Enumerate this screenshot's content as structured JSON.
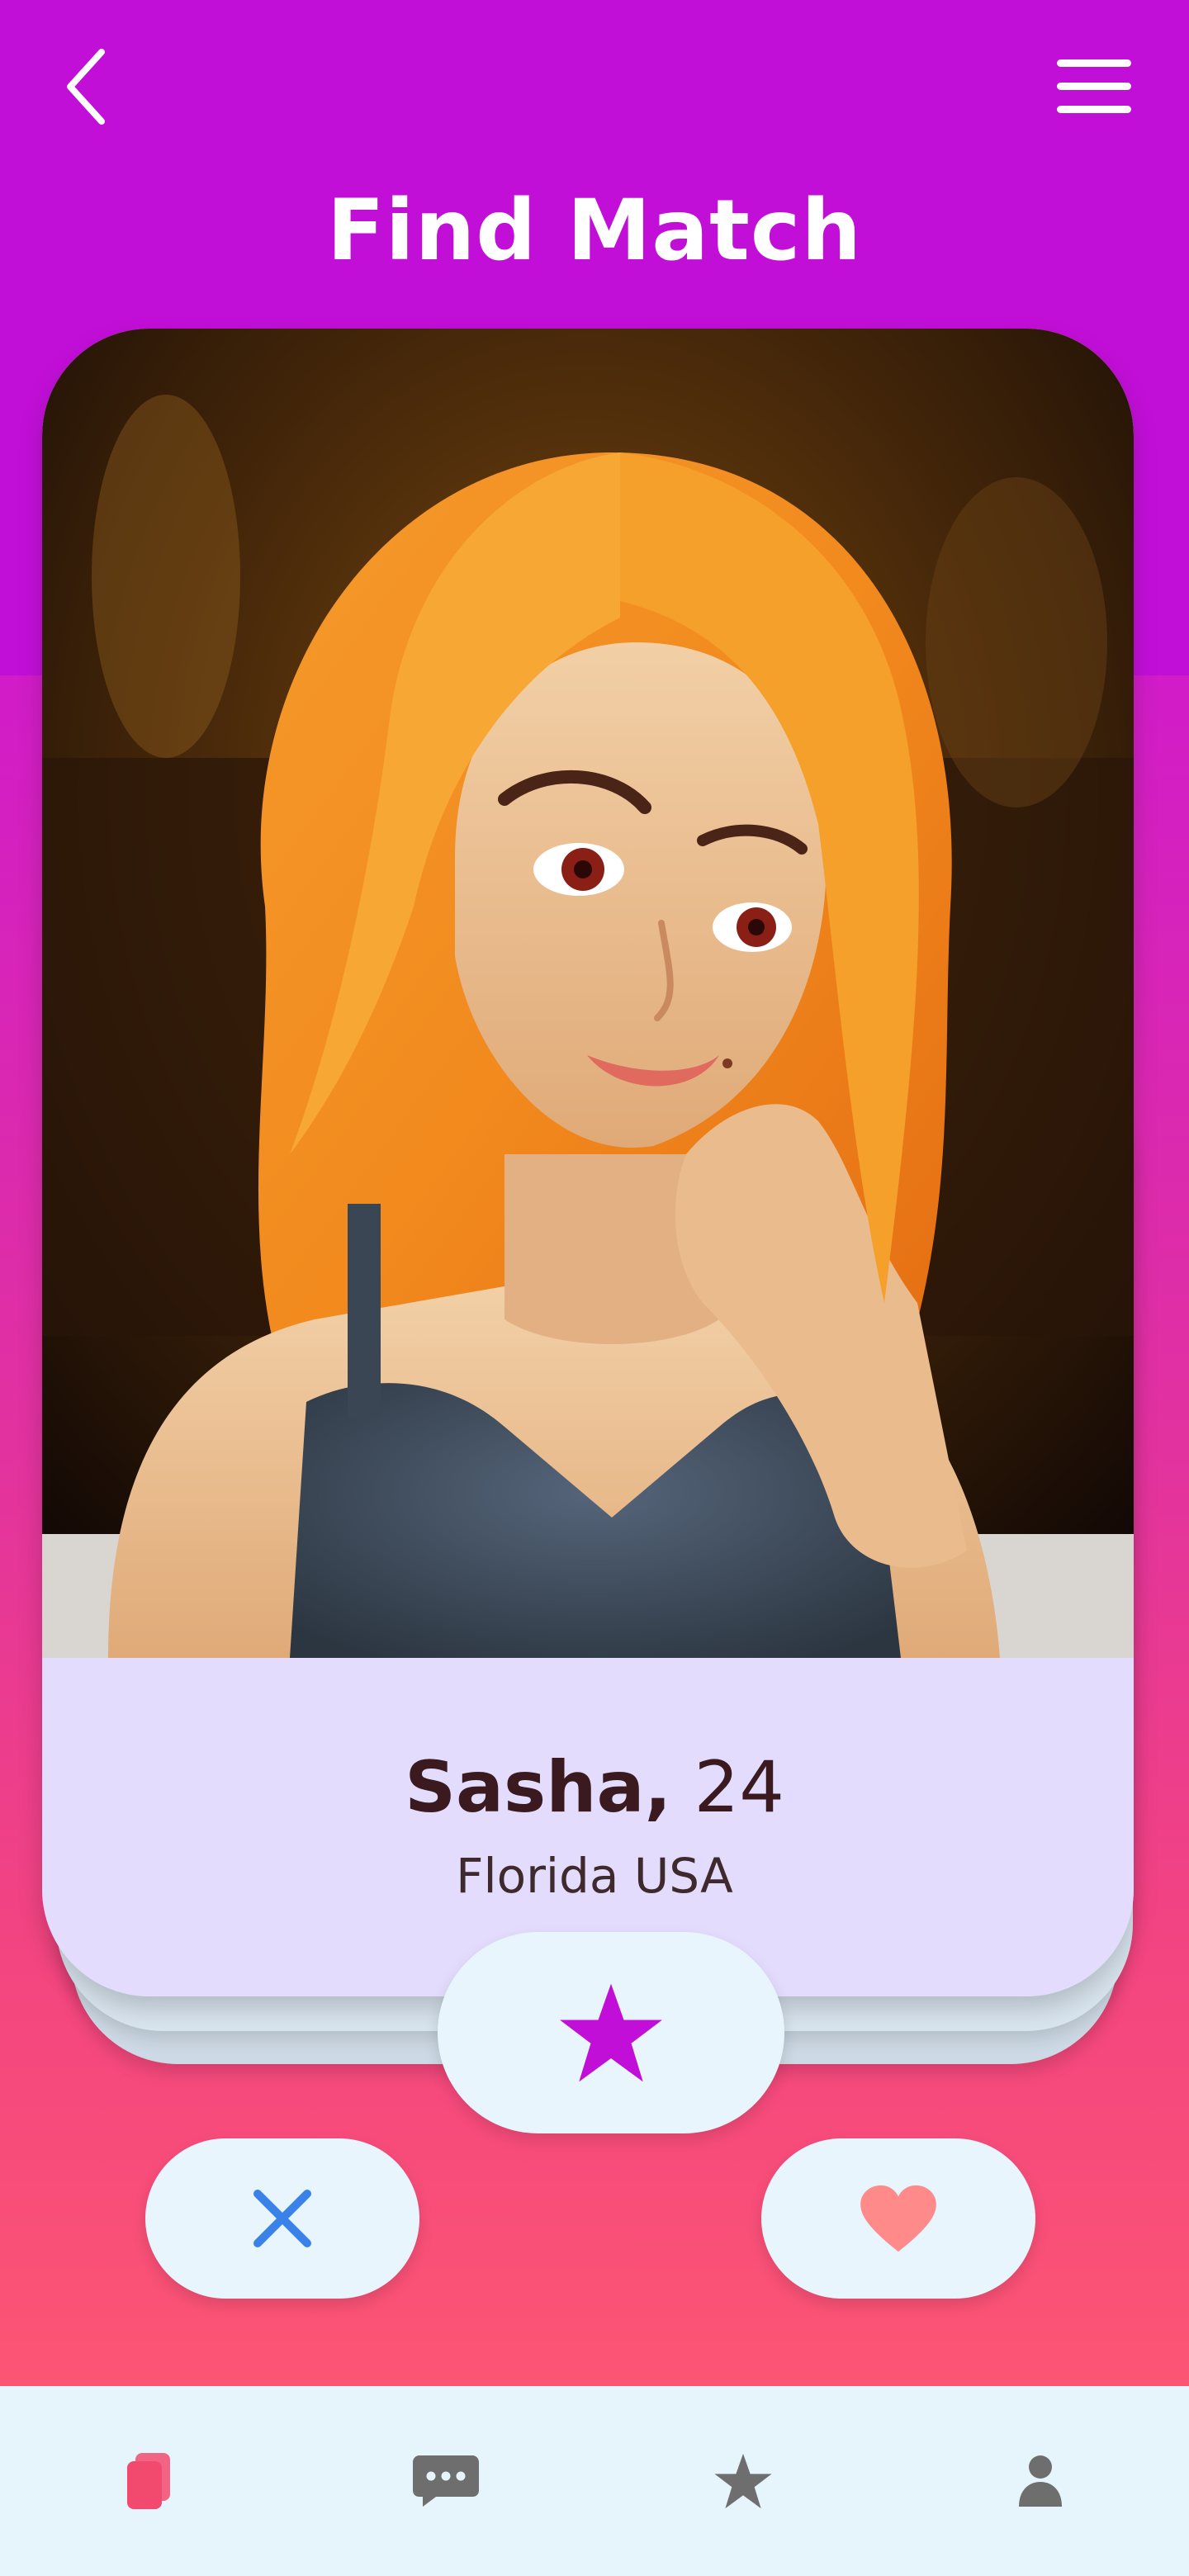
{
  "header": {
    "title": "Find Match",
    "back_icon": "chevron-left-icon",
    "menu_icon": "hamburger-menu-icon"
  },
  "profile": {
    "name": "Sasha,",
    "age": "24",
    "location": "Florida USA",
    "photo": "illustrated-portrait-red-hair-woman"
  },
  "actions": {
    "super_like_icon": "star-icon",
    "dislike_icon": "close-icon",
    "like_icon": "heart-icon"
  },
  "bottom_nav": {
    "items": [
      {
        "icon": "cards-icon",
        "active": true
      },
      {
        "icon": "chat-icon",
        "active": false
      },
      {
        "icon": "star-icon",
        "active": false
      },
      {
        "icon": "profile-icon",
        "active": false
      }
    ]
  },
  "colors": {
    "header_bg": "#c20fd8",
    "gradient_bottom": "#fc5573",
    "card_info_bg": "#e3dcfd",
    "button_bg": "#e8f5fc",
    "star": "#c20fd8",
    "close": "#3b82e8",
    "heart": "#ff8a8a",
    "nav_active": "#f24a6e",
    "nav_inactive": "#6e6e6e"
  }
}
